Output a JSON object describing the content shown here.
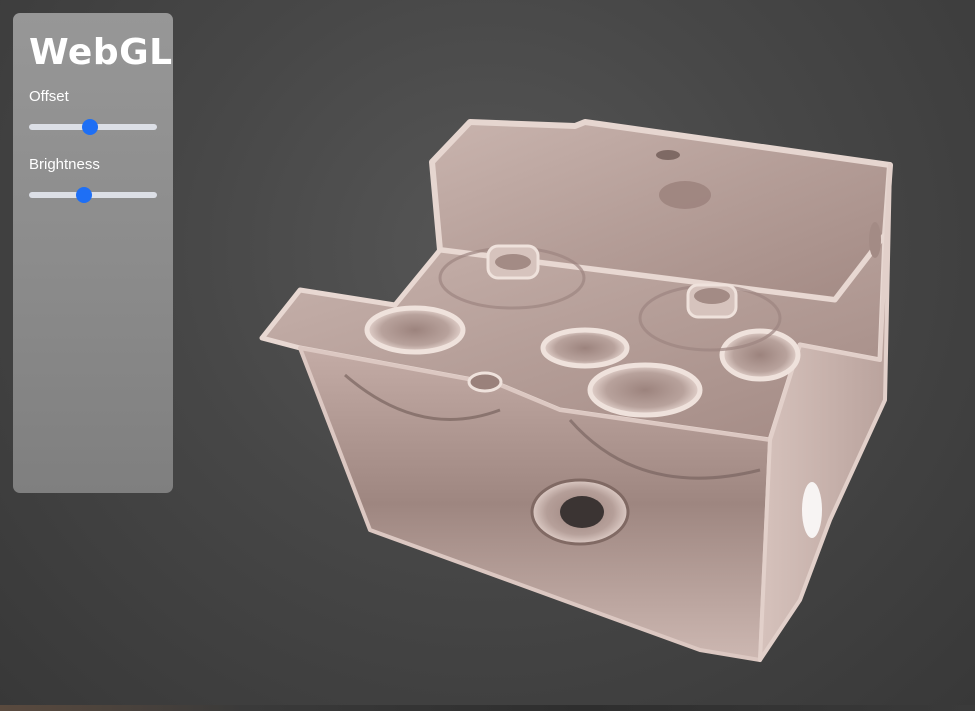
{
  "panel": {
    "title": "WebGL",
    "controls": [
      {
        "label": "Offset",
        "value": 0.48
      },
      {
        "label": "Brightness",
        "value": 0.43
      }
    ]
  },
  "colors": {
    "accent": "#1e6ff5",
    "background": "#474747",
    "panel": "#8e8e8e",
    "model": "#d8c3bd"
  },
  "viewport": {
    "object": "volume-rendered engine block"
  }
}
